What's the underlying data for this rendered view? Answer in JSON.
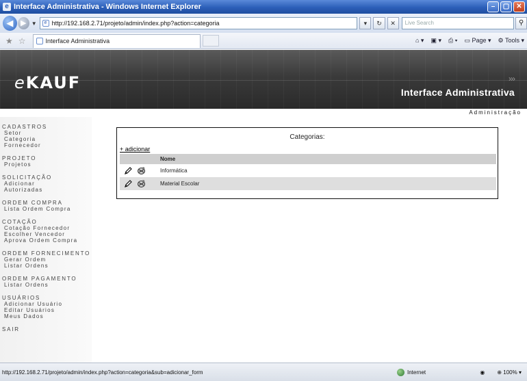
{
  "window": {
    "title": "Interface Administrativa - Windows Internet Explorer"
  },
  "address_bar": {
    "url": "http://192.168.2.71/projeto/admin/index.php?action=categoria",
    "search_placeholder": "Live Search"
  },
  "tab": {
    "label": "Interface Administrativa"
  },
  "command_bar": {
    "page": "Page",
    "tools": "Tools"
  },
  "site": {
    "logo_prefix": "e",
    "logo_rest": "KAUF",
    "header_title": "Interface Administrativa",
    "admin_label": "Administração"
  },
  "sidebar": {
    "groups": [
      {
        "heading": "CADASTROS",
        "links": [
          "Setor",
          "Categoria",
          "Fornecedor"
        ]
      },
      {
        "heading": "PROJETO",
        "links": [
          "Projetos"
        ]
      },
      {
        "heading": "SOLICITAÇÃO",
        "links": [
          "Adicionar",
          "Autorizadas"
        ]
      },
      {
        "heading": "ORDEM COMPRA",
        "links": [
          "Lista Ordem Compra"
        ]
      },
      {
        "heading": "COTAÇÃO",
        "links": [
          "Cotação Fornecedor",
          "Escolher Vencedor",
          "Aprova Ordem Compra"
        ]
      },
      {
        "heading": "ORDEM FORNECIMENTO",
        "links": [
          "Gerar Ordem",
          "Listar Ordens"
        ]
      },
      {
        "heading": "ORDEM PAGAMENTO",
        "links": [
          "Listar Ordens"
        ]
      },
      {
        "heading": "USUÁRIOS",
        "links": [
          "Adicionar Usuário",
          "Editar Usuários",
          "Meus Dados"
        ]
      },
      {
        "heading": "SAIR",
        "links": []
      }
    ]
  },
  "main": {
    "panel_title": "Categorias:",
    "add_link": "+ adicionar",
    "table": {
      "columns": [
        "",
        "Nome"
      ],
      "rows": [
        "Informática",
        "Material Escolar"
      ]
    }
  },
  "statusbar": {
    "url": "http://192.168.2.71/projeto/admin/index.php?action=categoria&sub=adicionar_form",
    "zone": "Internet",
    "zoom": "100%"
  },
  "colors": {
    "header_bg": "#3a3a3a",
    "table_header_bg": "#cfcfcf",
    "alt_row_bg": "#dedede"
  }
}
